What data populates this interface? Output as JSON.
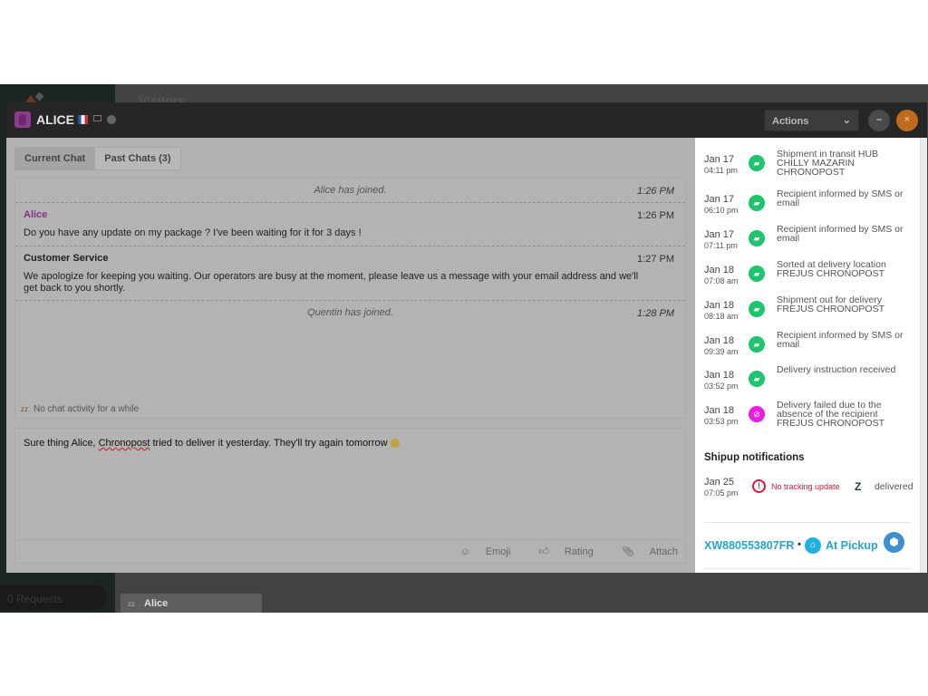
{
  "background": {
    "visitors_label": "Visitors",
    "requests_label": "0 Requests",
    "chat_tab_name": "Alice"
  },
  "header": {
    "visitor_name": "ALICE",
    "actions_label": "Actions",
    "minimize": "–",
    "close": "×"
  },
  "tabs": [
    {
      "label": "Current Chat",
      "active": true
    },
    {
      "label": "Past Chats (3)",
      "active": false
    }
  ],
  "messages": [
    {
      "type": "system",
      "text": "Alice has joined.",
      "time": "1:26 PM"
    },
    {
      "type": "visitor",
      "author": "Alice",
      "text": "Do you have any update on my package ? I've been waiting for it for 3 days !",
      "time": "1:26 PM"
    },
    {
      "type": "agent",
      "author": "Customer Service",
      "text": "We apologize for keeping you waiting. Our operators are busy at the moment, please leave us a message with your email address and we'll get back to you shortly.",
      "time": "1:27 PM"
    },
    {
      "type": "system",
      "text": "Quentin has joined.",
      "time": "1:28 PM"
    }
  ],
  "idle_notice": "No chat activity for a while",
  "compose": {
    "before": "Sure thing Alice, ",
    "misspelled": "Chronopost",
    "after": " tried to deliver it yesterday. They'll try again tomorrow ",
    "emoji": "grinning-face"
  },
  "tools": {
    "emoji": "Emoji",
    "rating": "Rating",
    "attach": "Attach"
  },
  "tracking_events": [
    {
      "date": "Jan 17",
      "time": "04:11 pm",
      "icon": "truck-icon",
      "color": "#1ec46e",
      "text": "Shipment in transit HUB CHILLY MAZARIN CHRONOPOST"
    },
    {
      "date": "Jan 17",
      "time": "06:10 pm",
      "icon": "truck-icon",
      "color": "#1ec46e",
      "text": "Recipient informed by SMS or email"
    },
    {
      "date": "Jan 17",
      "time": "07:11 pm",
      "icon": "truck-icon",
      "color": "#1ec46e",
      "text": "Recipient informed by SMS or email"
    },
    {
      "date": "Jan 18",
      "time": "07:08 am",
      "icon": "truck-icon",
      "color": "#1ec46e",
      "text": "Sorted at delivery location FREJUS CHRONOPOST"
    },
    {
      "date": "Jan 18",
      "time": "08:18 am",
      "icon": "truck-icon",
      "color": "#1ec46e",
      "text": "Shipment out for delivery FREJUS CHRONOPOST"
    },
    {
      "date": "Jan 18",
      "time": "09:39 am",
      "icon": "truck-icon",
      "color": "#1ec46e",
      "text": "Recipient informed by SMS or email"
    },
    {
      "date": "Jan 18",
      "time": "03:52 pm",
      "icon": "truck-icon",
      "color": "#1ec46e",
      "text": "Delivery instruction received"
    },
    {
      "date": "Jan 18",
      "time": "03:53 pm",
      "icon": "delivery-failed-icon",
      "color": "#e81ee0",
      "text": "Delivery failed due to the absence of the recipient FREJUS CHRONOPOST"
    }
  ],
  "shipup": {
    "title": "Shipup notifications",
    "date": "Jan 25",
    "time": "07:05 pm",
    "status": "No tracking update",
    "zendesk_status": "delivered"
  },
  "tracking": {
    "number": "XW880553807FR",
    "separator": "•",
    "status": "At Pickup",
    "accent": "#27a4c8"
  }
}
